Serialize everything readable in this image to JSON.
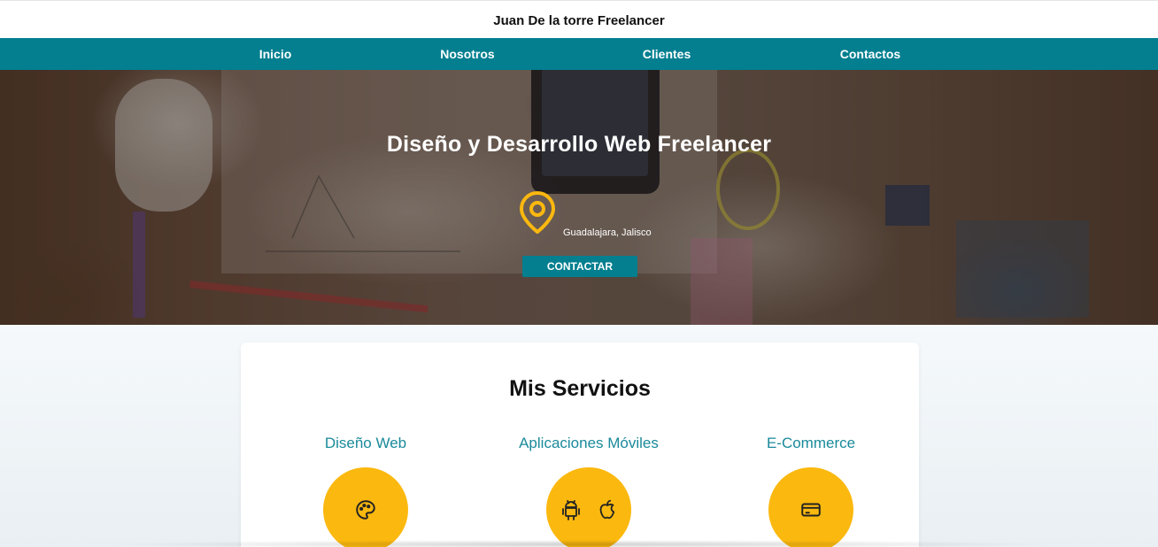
{
  "header": {
    "site_title": "Juan De la torre Freelancer"
  },
  "nav": {
    "items": [
      {
        "label": "Inicio"
      },
      {
        "label": "Nosotros"
      },
      {
        "label": "Clientes"
      },
      {
        "label": "Contactos"
      }
    ],
    "background_color": "#037f90"
  },
  "hero": {
    "title": "Diseño y Desarrollo Web Freelancer",
    "location_icon": "map-pin-icon",
    "location": "Guadalajara, Jalisco",
    "cta_label": "CONTACTAR",
    "accent_color": "#fbb80f"
  },
  "services": {
    "title": "Mis Servicios",
    "items": [
      {
        "name": "Diseño Web",
        "icons": [
          "palette-icon"
        ]
      },
      {
        "name": "Aplicaciones Móviles",
        "icons": [
          "android-icon",
          "apple-icon"
        ]
      },
      {
        "name": "E-Commerce",
        "icons": [
          "credit-card-icon"
        ]
      }
    ],
    "title_color": "#1a8a9a",
    "circle_color": "#fbb80f"
  }
}
